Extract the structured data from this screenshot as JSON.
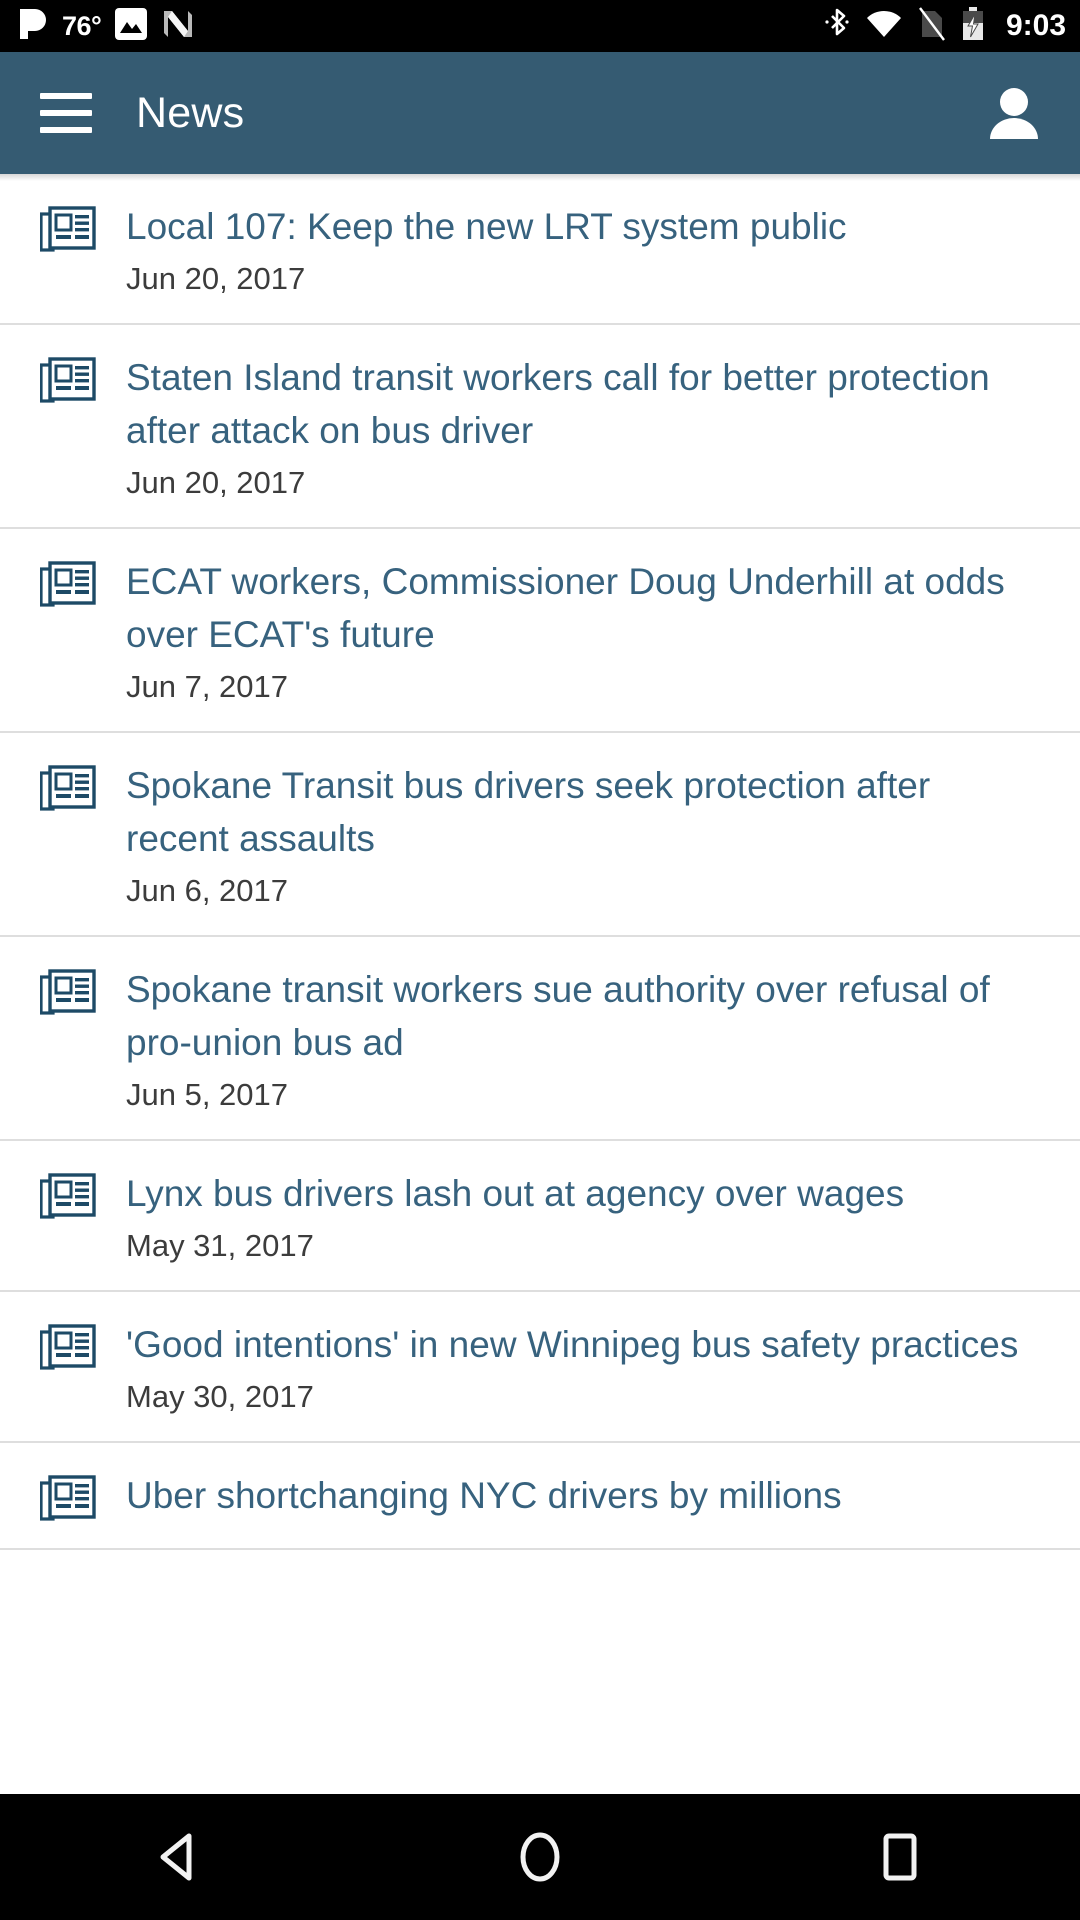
{
  "status_bar": {
    "temperature": "76°",
    "clock": "9:03",
    "icons_left": [
      "pandora-icon",
      "temperature-label",
      "image-icon",
      "nvidia-n-icon"
    ],
    "icons_right": [
      "bluetooth-icon",
      "wifi-icon",
      "no-sim-icon",
      "battery-charging-icon"
    ]
  },
  "app_bar": {
    "menu_icon": "hamburger-menu-icon",
    "title": "News",
    "account_icon": "account-person-icon",
    "background_color": "#355B72"
  },
  "colors": {
    "accent": "#355B72",
    "title_text": "#37627E",
    "date_text": "#3c3c3c",
    "divider": "#dedede"
  },
  "news": {
    "item_icon": "newspaper-icon",
    "items": [
      {
        "title": "Local 107: Keep the new LRT system public",
        "date": "Jun 20, 2017"
      },
      {
        "title": "Staten Island transit workers call for better protection after attack on bus driver",
        "date": "Jun 20, 2017"
      },
      {
        "title": "ECAT workers, Commissioner Doug Underhill at odds over ECAT's future",
        "date": "Jun 7, 2017"
      },
      {
        "title": "Spokane Transit bus drivers seek protection after recent assaults",
        "date": "Jun 6, 2017"
      },
      {
        "title": "Spokane transit workers sue authority over refusal of pro-union bus ad",
        "date": "Jun 5, 2017"
      },
      {
        "title": "Lynx bus drivers lash out at agency over wages",
        "date": "May 31, 2017"
      },
      {
        "title": "'Good intentions' in new Winnipeg bus safety practices",
        "date": "May 30, 2017"
      },
      {
        "title": "Uber shortchanging NYC drivers by millions",
        "date": ""
      }
    ]
  },
  "nav_bar": {
    "back": "back-triangle-icon",
    "home": "home-circle-icon",
    "recents": "recents-square-icon"
  }
}
